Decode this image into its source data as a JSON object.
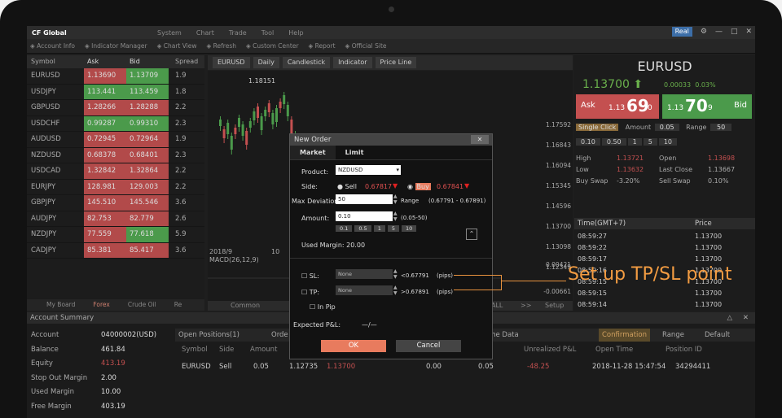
{
  "app": {
    "logo": "CF Global",
    "menu": [
      "System",
      "Chart",
      "Trade",
      "Tool",
      "Help"
    ],
    "account_button": "Real"
  },
  "toolbar": [
    "Account Info",
    "Indicator Manager",
    "Chart View",
    "Refresh",
    "Custom Center",
    "Report",
    "Official Site"
  ],
  "quotes": {
    "headers": [
      "Symbol",
      "Ask",
      "Bid",
      "Spread"
    ],
    "rows": [
      {
        "symbol": "EURUSD",
        "ask": "1.13690",
        "bid": "1.13709",
        "spread": "1.9",
        "ask_color": "red",
        "bid_color": "green"
      },
      {
        "symbol": "USDJPY",
        "ask": "113.441",
        "bid": "113.459",
        "spread": "1.8",
        "ask_color": "green",
        "bid_color": "green"
      },
      {
        "symbol": "GBPUSD",
        "ask": "1.28266",
        "bid": "1.28288",
        "spread": "2.2",
        "ask_color": "red",
        "bid_color": "red"
      },
      {
        "symbol": "USDCHF",
        "ask": "0.99287",
        "bid": "0.99310",
        "spread": "2.3",
        "ask_color": "green",
        "bid_color": "green"
      },
      {
        "symbol": "AUDUSD",
        "ask": "0.72945",
        "bid": "0.72964",
        "spread": "1.9",
        "ask_color": "red",
        "bid_color": "red"
      },
      {
        "symbol": "NZDUSD",
        "ask": "0.68378",
        "bid": "0.68401",
        "spread": "2.3",
        "ask_color": "red",
        "bid_color": "red"
      },
      {
        "symbol": "USDCAD",
        "ask": "1.32842",
        "bid": "1.32864",
        "spread": "2.2",
        "ask_color": "red",
        "bid_color": "red"
      },
      {
        "symbol": "EURJPY",
        "ask": "128.981",
        "bid": "129.003",
        "spread": "2.2",
        "ask_color": "red",
        "bid_color": "red"
      },
      {
        "symbol": "GBPJPY",
        "ask": "145.510",
        "bid": "145.546",
        "spread": "3.6",
        "ask_color": "red",
        "bid_color": "red"
      },
      {
        "symbol": "AUDJPY",
        "ask": "82.753",
        "bid": "82.779",
        "spread": "2.6",
        "ask_color": "red",
        "bid_color": "red"
      },
      {
        "symbol": "NZDJPY",
        "ask": "77.559",
        "bid": "77.618",
        "spread": "5.9",
        "ask_color": "red",
        "bid_color": "green"
      },
      {
        "symbol": "CADJPY",
        "ask": "85.381",
        "bid": "85.417",
        "spread": "3.6",
        "ask_color": "red",
        "bid_color": "red"
      }
    ],
    "tabs": [
      "My Board",
      "Forex",
      "Crude Oil",
      "Re"
    ]
  },
  "chart": {
    "symbol": "EURUSD",
    "period": "Daily",
    "type": "Candlestick",
    "indicator": "Indicator",
    "priceline": "Price Line",
    "high_label": "1.18151",
    "y_labels": [
      "1.17592",
      "1.16843",
      "1.16094",
      "1.15345",
      "1.14596",
      "1.13700",
      "1.13098",
      "1.12349"
    ],
    "date_label": "2018/9",
    "day_label": "10",
    "macd_label": "MACD(26,12,9)",
    "macd_values": [
      "0.00421",
      "-0.00661"
    ],
    "footer": [
      "Common",
      "ALL",
      ">>",
      "Setup"
    ]
  },
  "detail": {
    "symbol": "EURUSD",
    "price": "1.13700",
    "change": "0.00033",
    "change_pct": "0.03%",
    "ask_label": "Ask",
    "ask_pre": "1.13",
    "ask_big": "69",
    "ask_post": "0",
    "bid_label": "Bid",
    "bid_pre": "1.13",
    "bid_big": "70",
    "bid_post": "9",
    "single_click": "Single Click",
    "amount_label": "Amount",
    "amount": "0.05",
    "range_label": "Range",
    "range": "50",
    "lots": [
      "0.10",
      "0.50",
      "1",
      "5",
      "10"
    ],
    "high_label": "High",
    "high": "1.13721",
    "low_label": "Low",
    "low": "1.13632",
    "open_label": "Open",
    "open": "1.13698",
    "last_close_label": "Last Close",
    "last_close": "1.13667",
    "buy_swap_label": "Buy Swap",
    "buy_swap": "-3.20%",
    "sell_swap_label": "Sell Swap",
    "sell_swap": "0.10%",
    "trade_headers": [
      "Time(GMT+7)",
      "Price"
    ],
    "trades": [
      [
        "08:59:27",
        "1.13700"
      ],
      [
        "08:59:22",
        "1.13700"
      ],
      [
        "08:59:17",
        "1.13700"
      ],
      [
        "08:59:16",
        "1.13700"
      ],
      [
        "08:59:15",
        "1.13700"
      ],
      [
        "08:59:15",
        "1.13700"
      ],
      [
        "08:59:14",
        "1.13700"
      ]
    ]
  },
  "summary": {
    "title": "Account Summary",
    "rows": [
      [
        "Account",
        "04000002(USD)"
      ],
      [
        "Balance",
        "461.84"
      ],
      [
        "Equity",
        "413.19"
      ],
      [
        "Stop Out Margin",
        "2.00"
      ],
      [
        "Used Margin",
        "10.00"
      ],
      [
        "Free Margin",
        "403.19"
      ]
    ]
  },
  "positions": {
    "tabs": [
      "Open Positions(1)",
      "Orde",
      "ame Data",
      "Confirmation",
      "Range",
      "Default"
    ],
    "headers": [
      "Symbol",
      "Side",
      "Amount",
      "Unrealized P&L",
      "Open Time",
      "Position ID"
    ],
    "row": [
      "EURUSD",
      "Sell",
      "0.05",
      "1.12735",
      "1.13700",
      "0.00",
      "0.05",
      "-48.25",
      "2018-11-28 15:47:54",
      "34294411"
    ]
  },
  "dialog": {
    "title": "New Order",
    "tabs": [
      "Market",
      "Limit"
    ],
    "product_label": "Product:",
    "product": "NZDUSD",
    "side_label": "Side:",
    "sell": "Sell",
    "sell_price": "0.67817",
    "buy": "Buy",
    "buy_price": "0.67841",
    "maxdev_label": "Max Deviation",
    "maxdev": "50",
    "range_label": "Range",
    "range": "(0.67791 - 0.67891)",
    "amount_label": "Amount:",
    "amount": "0.10",
    "amount_range": "(0.05-50)",
    "lots": [
      "0.1",
      "0.5",
      "1",
      "5",
      "10"
    ],
    "used_margin": "Used Margin: 20.00",
    "sl_label": "SL:",
    "sl_value": "None",
    "sl_price": "<0.67791",
    "sl_unit": "(pips)",
    "tp_label": "TP:",
    "tp_value": "None",
    "tp_price": ">0.67891",
    "tp_unit": "(pips)",
    "in_pip": "In Pip",
    "exp_pnl": "Expected P&L:",
    "exp_val": "—/—",
    "ok": "OK",
    "cancel": "Cancel"
  },
  "callout": "Set up TP/SL point"
}
